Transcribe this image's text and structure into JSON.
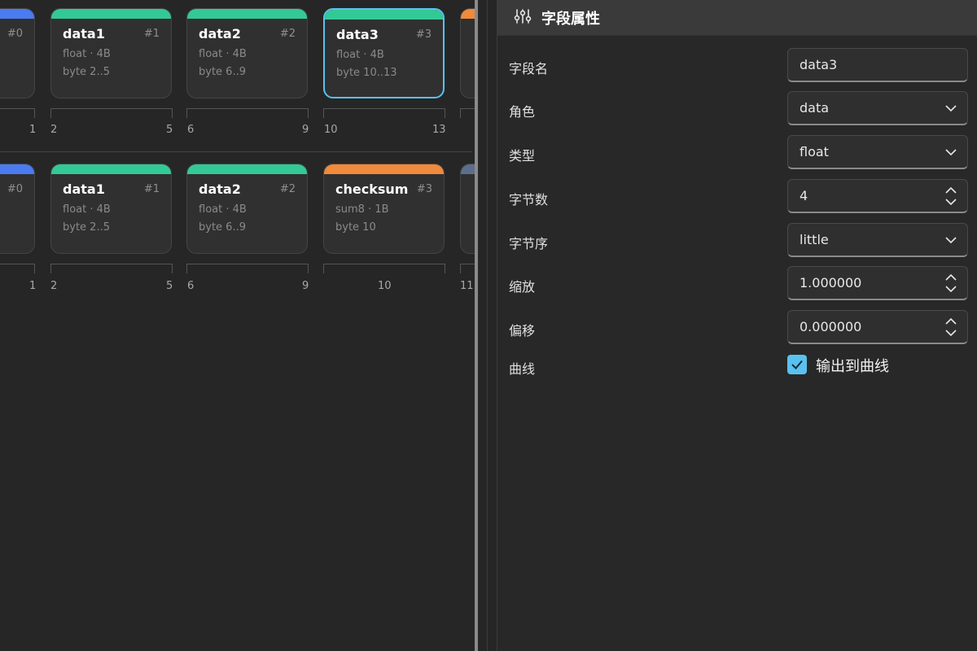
{
  "rows": [
    {
      "cards": [
        {
          "name": "",
          "idx": "#0",
          "meta1": "",
          "meta2": "",
          "color": "#4a7bf0"
        },
        {
          "name": "data1",
          "idx": "#1",
          "meta1": "float · 4B",
          "meta2": "byte 2..5",
          "color": "#33c996"
        },
        {
          "name": "data2",
          "idx": "#2",
          "meta1": "float · 4B",
          "meta2": "byte 6..9",
          "color": "#33c996"
        },
        {
          "name": "data3",
          "idx": "#3",
          "meta1": "float · 4B",
          "meta2": "byte 10..13",
          "color": "#33c996"
        },
        {
          "name": "",
          "idx": "",
          "meta1": "",
          "meta2": "",
          "color": "#f08a3c"
        }
      ],
      "ticks": [
        "1",
        "2",
        "5",
        "6",
        "9",
        "10",
        "13"
      ]
    },
    {
      "cards": [
        {
          "name": "",
          "idx": "#0",
          "meta1": "",
          "meta2": "",
          "color": "#4a7bf0"
        },
        {
          "name": "data1",
          "idx": "#1",
          "meta1": "float · 4B",
          "meta2": "byte 2..5",
          "color": "#33c996"
        },
        {
          "name": "data2",
          "idx": "#2",
          "meta1": "float · 4B",
          "meta2": "byte 6..9",
          "color": "#33c996"
        },
        {
          "name": "checksum",
          "idx": "#3",
          "meta1": "sum8 · 1B",
          "meta2": "byte 10",
          "color": "#f08a3c"
        },
        {
          "name": "",
          "idx": "",
          "meta1": "",
          "meta2": "",
          "color": "#5c6f8a"
        }
      ],
      "ticks": [
        "1",
        "2",
        "5",
        "6",
        "9",
        "10",
        "11"
      ]
    }
  ],
  "props": {
    "title": "字段属性",
    "icon": "sliders-icon",
    "fields": [
      {
        "label": "字段名",
        "value": "data3",
        "kind": "text"
      },
      {
        "label": "角色",
        "value": "data",
        "kind": "select"
      },
      {
        "label": "类型",
        "value": "float",
        "kind": "select"
      },
      {
        "label": "字节数",
        "value": "4",
        "kind": "spin"
      },
      {
        "label": "字节序",
        "value": "little",
        "kind": "select"
      },
      {
        "label": "缩放",
        "value": "1.000000",
        "kind": "spin"
      },
      {
        "label": "偏移",
        "value": "0.000000",
        "kind": "spin"
      }
    ],
    "curve_label": "曲线",
    "curve_checkbox_label": "输出到曲线",
    "curve_checked": true
  }
}
